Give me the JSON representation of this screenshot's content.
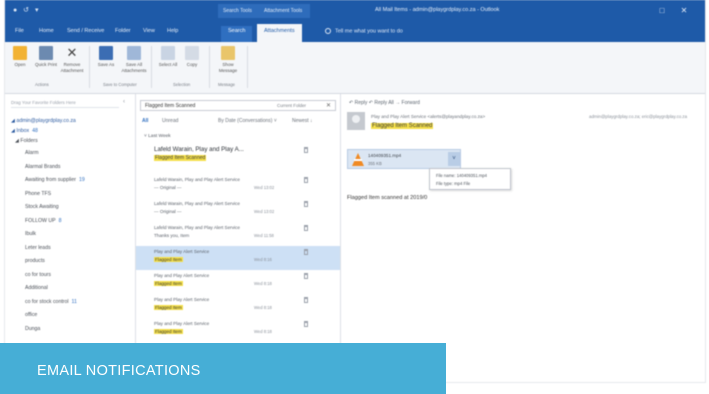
{
  "caption": "EMAIL NOTIFICATIONS",
  "colors": {
    "ribbon_blue": "#1e5aa8",
    "banner": "#46aed6",
    "selection": "#cde0f5",
    "highlight": "#f5e04a"
  },
  "titlebar": {
    "quick_access": "● ↺ ▾",
    "context_group_1": "Search Tools",
    "context_group_2": "Attachment Tools",
    "window_title": "All Mail Items - admin@playgrdplay.co.za - Outlook",
    "restore": "□",
    "close": "✕"
  },
  "tabs": {
    "file": "File",
    "home": "Home",
    "send_receive": "Send / Receive",
    "folder": "Folder",
    "view": "View",
    "help": "Help",
    "search": "Search",
    "attachments": "Attachments",
    "tell_me": "Tell me what you want to do"
  },
  "ribbon": {
    "open": "Open",
    "quick_print": "Quick Print",
    "remove_attachment": "Remove Attachment",
    "save_as": "Save As",
    "save_all": "Save All Attachments",
    "select_all": "Select All",
    "copy": "Copy",
    "show_message": "Show Message",
    "group_actions": "Actions",
    "group_save": "Save to Computer",
    "group_selection": "Selection",
    "group_message": "Message"
  },
  "folders": {
    "search_placeholder": "Drag Your Favorite Folders Here",
    "pin": "‹",
    "account": "◢ admin@playgrdplay.co.za",
    "inbox": "◢ Inbox",
    "inbox_count": "48",
    "folders_header": "◢ Folders",
    "items": [
      {
        "name": "Alarm",
        "count": ""
      },
      {
        "name": "Alarmal Brands",
        "count": ""
      },
      {
        "name": "Awaiting from supplier",
        "count": "19"
      },
      {
        "name": "Phone TFS",
        "count": ""
      },
      {
        "name": "Stock Awaiting",
        "count": ""
      },
      {
        "name": "FOLLOW UP",
        "count": "8"
      },
      {
        "name": "Ibulk",
        "count": ""
      },
      {
        "name": "Leter leads",
        "count": ""
      },
      {
        "name": "products",
        "count": ""
      },
      {
        "name": "co for tours",
        "count": ""
      },
      {
        "name": "Additional",
        "count": ""
      },
      {
        "name": "co for stock control",
        "count": "11"
      },
      {
        "name": "office",
        "count": ""
      },
      {
        "name": "Dunga",
        "count": ""
      }
    ]
  },
  "list": {
    "search_query": "Flagged Item Scanned",
    "scope": "Current Folder",
    "clear": "✕",
    "filter_all": "All",
    "filter_unread": "Unread",
    "sort": "By Date (Conversations) ˅",
    "order": "Newest ↓",
    "section": "˅ Last Week",
    "messages": [
      {
        "from": "Lafeld Warain, Play and Play A...",
        "preview": "Flagged Item Scanned",
        "time": "",
        "big": true,
        "selected": false
      },
      {
        "from": "Lafeld Warain, Play and Play Alert Service",
        "preview": "--- Original ---",
        "time": "Wed 13:02",
        "big": false,
        "selected": false
      },
      {
        "from": "Lafeld Warain, Play and Play Alert Service",
        "preview": "--- Original ---",
        "time": "Wed 13:02",
        "big": false,
        "selected": false
      },
      {
        "from": "Lafeld Warain, Play and Play Alert Service",
        "preview": "Thanks you, Item",
        "time": "Wed 11:58",
        "big": false,
        "selected": false
      },
      {
        "from": "Play and Play Alert Service",
        "preview": "Flagged Item",
        "time": "Wed 8:16",
        "big": false,
        "selected": true
      },
      {
        "from": "Play and Play Alert Service",
        "preview": "Flagged Item",
        "time": "Wed 8:18",
        "big": false,
        "selected": false
      },
      {
        "from": "Play and Play Alert Service",
        "preview": "Flagged Item",
        "time": "Wed 8:18",
        "big": false,
        "selected": false
      },
      {
        "from": "Play and Play Alert Service",
        "preview": "Flagged Item",
        "time": "Wed 8:18",
        "big": false,
        "selected": false
      }
    ]
  },
  "reading": {
    "actions": "↶ Reply   ↶ Reply All   → Forward",
    "from": "Play and Play Alert Service <alerts@playandplay.co.za>",
    "to": "admin@playgrdplay.co.za; eric@playgrdplay.co.za",
    "subject": "Flagged Item Scanned",
    "attachment_name": "140409351.mp4",
    "attachment_size": "355 KB",
    "attachment_menu": "˅",
    "tip_name": "File name: 140409351.mp4",
    "tip_type": "File type: mp4 File",
    "body": "Flagged Item scanned at 2019/0"
  }
}
